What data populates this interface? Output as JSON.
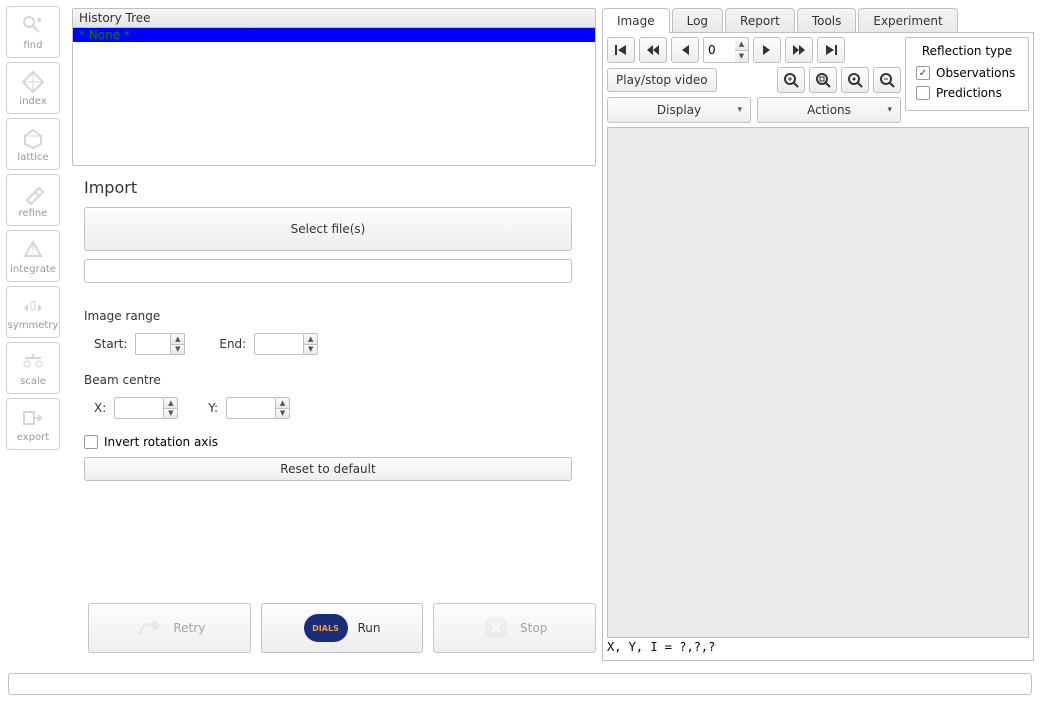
{
  "left_tools": {
    "find": "find",
    "index": "index",
    "lattice": "lattice",
    "refine": "refine",
    "integrate": "integrate",
    "symmetry": "symmetry",
    "scale": "scale",
    "export": "export"
  },
  "history": {
    "title": "History Tree",
    "item0": "* None *"
  },
  "import": {
    "title": "Import",
    "select_files": "Select file(s)",
    "file_display": "",
    "image_range_label": "Image range",
    "start_label": "Start:",
    "start_value": "",
    "end_label": "End:",
    "end_value": "",
    "beam_centre_label": "Beam centre",
    "x_label": "X:",
    "x_value": "",
    "y_label": "Y:",
    "y_value": "",
    "invert_label": "Invert rotation axis",
    "invert_checked": false,
    "reset_label": "Reset to default"
  },
  "actions": {
    "retry": "Retry",
    "run": "Run",
    "stop": "Stop",
    "dials": "DIALS"
  },
  "right": {
    "tabs": {
      "image": "Image",
      "log": "Log",
      "report": "Report",
      "tools": "Tools",
      "experiment": "Experiment"
    },
    "frame_value": "0",
    "play_label": "Play/stop video",
    "display_label": "Display",
    "actions_label": "Actions",
    "reflection": {
      "title": "Reflection type",
      "observations": "Observations",
      "observations_checked": true,
      "predictions": "Predictions",
      "predictions_checked": false
    },
    "coord_readout": "X, Y, I = ?,?,?"
  },
  "status_bar": ""
}
